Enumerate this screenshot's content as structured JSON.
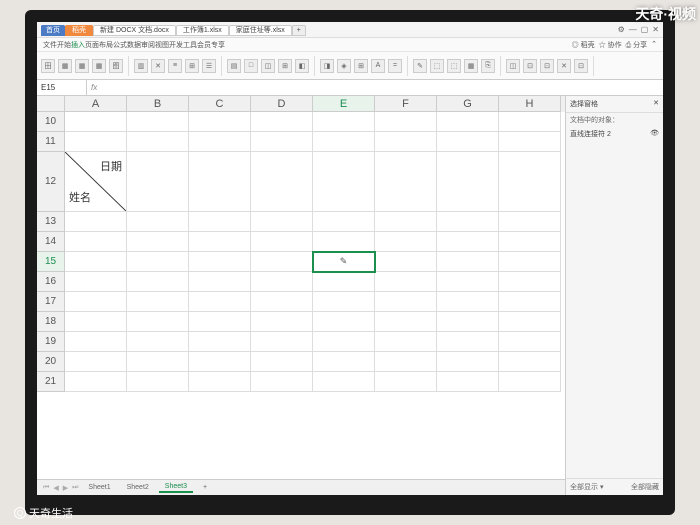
{
  "overlay": {
    "top": "天奇·视频",
    "bottom": "天奇生活",
    "logo_glyph": "Q"
  },
  "tabs": [
    {
      "label": "首页",
      "cls": "home"
    },
    {
      "label": "稻壳",
      "cls": "orange"
    },
    {
      "label": "新建 DOCX 文档.docx",
      "cls": ""
    },
    {
      "label": "工作簿1.xlsx",
      "cls": ""
    },
    {
      "label": "家庭住址等.xlsx",
      "cls": ""
    },
    {
      "label": "+",
      "cls": "plus"
    }
  ],
  "win_controls": [
    "⚙",
    "—",
    "▢",
    "✕"
  ],
  "menu": {
    "items": [
      "文件",
      "开始",
      "插入",
      "页面布局",
      "公式",
      "数据",
      "审阅",
      "视图",
      "开发工具",
      "会员专享"
    ],
    "active": "插入",
    "right": [
      "◎ 稻壳",
      "☆ 协作",
      "⎙ 分享",
      "⌃"
    ]
  },
  "ribbon_icons": [
    "田",
    "▦",
    "▦",
    "▦",
    "图",
    "▥",
    "✕",
    "≡",
    "⊞",
    "☰",
    "▤",
    "□",
    "◫",
    "⊞",
    "◧",
    "◨",
    "◈",
    "⊞",
    "A",
    "=",
    "✎",
    "⬚",
    "⬚",
    "▦",
    "⎘",
    "◫",
    "⊡",
    "⊡",
    "✕",
    "⊡"
  ],
  "namebox": "E15",
  "fx_label": "fx",
  "columns": [
    "A",
    "B",
    "C",
    "D",
    "E",
    "F",
    "G",
    "H"
  ],
  "selected_col": "E",
  "rows": [
    10,
    11,
    12,
    13,
    14,
    15,
    16,
    17,
    18,
    19,
    20,
    21
  ],
  "tall_row": 12,
  "selected_row": 15,
  "selected_cell": {
    "row": 15,
    "col": "E"
  },
  "diag_cell": {
    "row": 12,
    "col": "A",
    "top": "日期",
    "bottom": "姓名"
  },
  "cursor_glyph": "✎",
  "side": {
    "title": "选择窗格",
    "close": "✕",
    "sub": "文档中的对象：",
    "items": [
      "直线连接符 2"
    ],
    "icon_glyph": "👁",
    "footer_left": "全部显示 ▾",
    "footer_right": "全部隐藏"
  },
  "sheets": {
    "nav": [
      "⏮",
      "◀",
      "▶",
      "⏭"
    ],
    "tabs": [
      {
        "label": "Sheet1",
        "active": false
      },
      {
        "label": "Sheet2",
        "active": false
      },
      {
        "label": "Sheet3",
        "active": true
      }
    ],
    "plus": "+"
  }
}
